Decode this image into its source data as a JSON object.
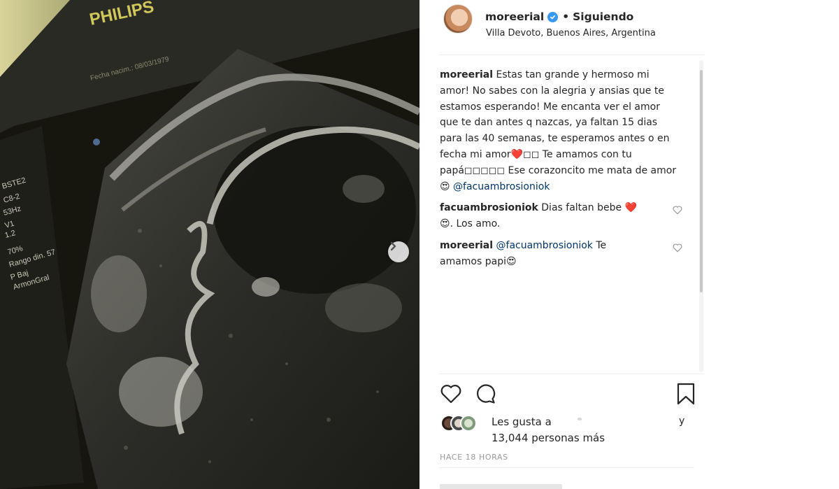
{
  "post": {
    "username": "moreerial",
    "follow_status": "Siguiendo",
    "separator": "•",
    "location": "Villa Devoto, Buenos Aires, Argentina",
    "timestamp": "HACE 18 HORAS"
  },
  "photo": {
    "monitor_brand": "PHILIPS",
    "overlay_text": [
      "BSTE2",
      "C8-2",
      "53Hz",
      "V1",
      "1.2",
      "70%",
      "Rango din. 57",
      "P Baj",
      "ArmonGral"
    ],
    "header_text": "Fecha nacim.: 08/03/1979",
    "next_icon": "chevron-right-icon"
  },
  "caption": {
    "author": "moreerial",
    "text": "Estas tan grande y hermoso mi amor! No sabes con la alegria y ansias que te estamos esperando! Me encanta ver el amor que te dan antes q nazcas, ya faltan 15 dias para las 40 semanas, te esperamos antes o en fecha mi amor❤️◻◻ Te amamos con tu papá◻◻◻◻◻ Ese corazoncito me mata de amor😍 ",
    "mention": "@facuambrosioniok"
  },
  "comments": [
    {
      "author": "facuambrosioniok",
      "text": "Dias faltan bebe ❤️ 😍. Los amo.",
      "mention": ""
    },
    {
      "author": "moreerial",
      "text": " Te amamos papi😍",
      "mention": "@facuambrosioniok"
    }
  ],
  "likes": {
    "prefix": "Les gusta a",
    "and": "y",
    "others": "13,044 personas más"
  },
  "icons": {
    "like": "heart-icon",
    "comment": "comment-icon",
    "save": "bookmark-icon",
    "verified": "verified-badge-icon"
  },
  "colors": {
    "link": "#003569",
    "verified": "#3897f0",
    "muted": "#999999",
    "text": "#262626"
  }
}
